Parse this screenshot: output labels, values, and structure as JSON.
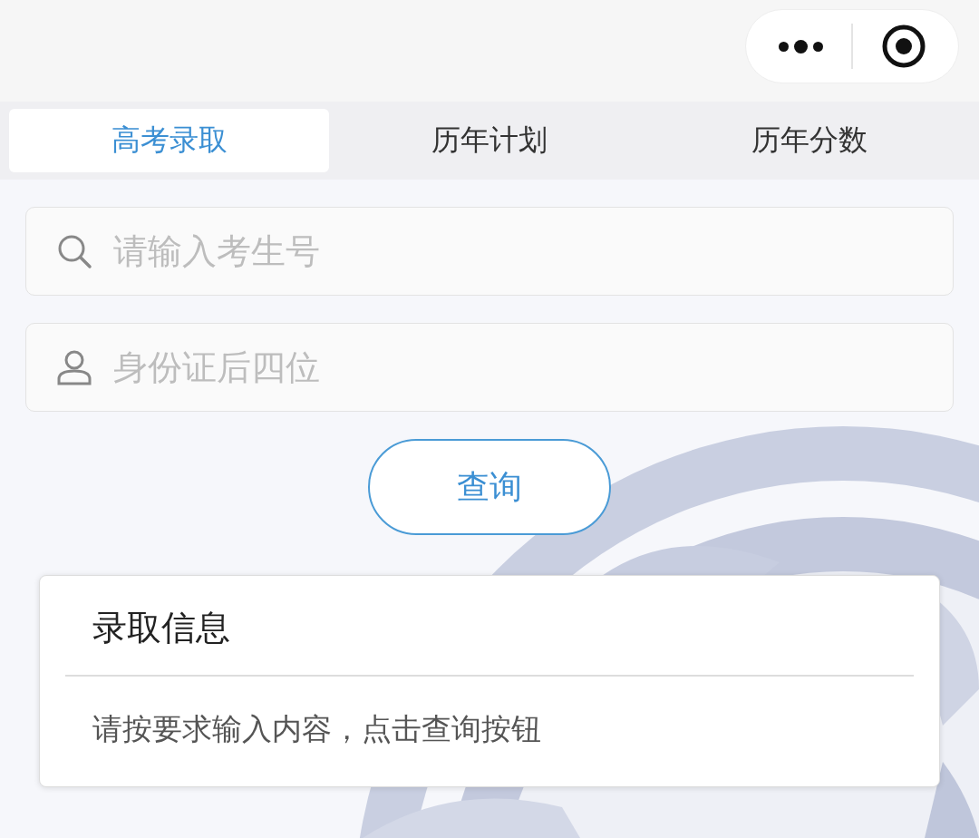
{
  "tabs": [
    {
      "label": "高考录取",
      "selected": true
    },
    {
      "label": "历年计划",
      "selected": false
    },
    {
      "label": "历年分数",
      "selected": false
    }
  ],
  "fields": [
    {
      "kind": "search",
      "placeholder": "请输入考生号"
    },
    {
      "kind": "person",
      "placeholder": "身份证后四位"
    }
  ],
  "query_button": "查询",
  "card": {
    "title": "录取信息",
    "message": "请按要求输入内容，点击查询按钮"
  }
}
